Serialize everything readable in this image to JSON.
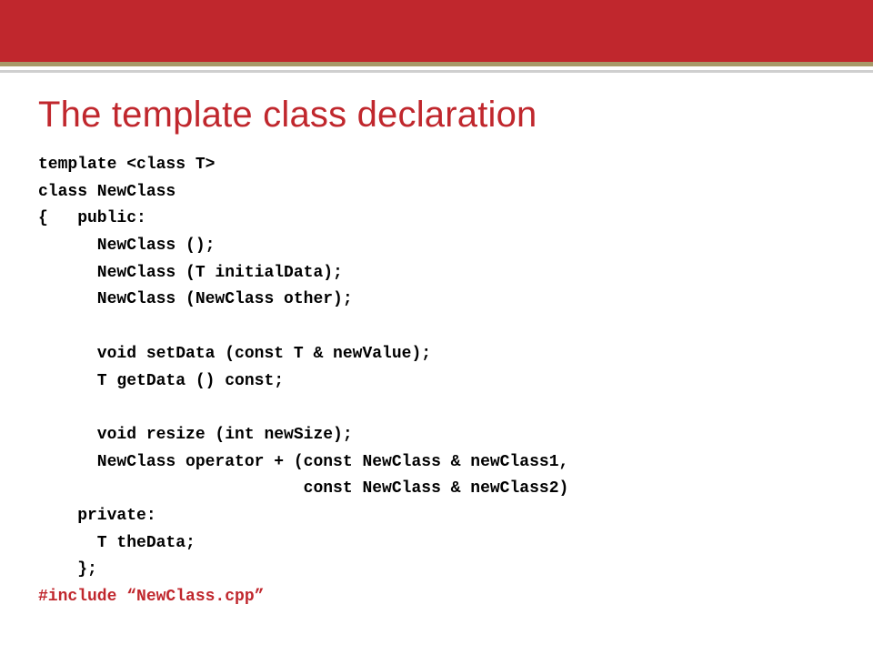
{
  "title": "The template class declaration",
  "code": {
    "l1": "template <class T>",
    "l2": "class NewClass",
    "l3": "{   public:",
    "l4": "      NewClass ();",
    "l5": "      NewClass (T initialData);",
    "l6": "      NewClass (NewClass other);",
    "l7": "",
    "l8": "      void setData (const T & newValue);",
    "l9": "      T getData () const;",
    "l10": "",
    "l11": "      void resize (int newSize);",
    "l12": "      NewClass operator + (const NewClass & newClass1,",
    "l13": "                           const NewClass & newClass2)",
    "l14": "    private:",
    "l15": "      T theData;",
    "l16": "    };",
    "l17": "#include “NewClass.cpp”"
  }
}
